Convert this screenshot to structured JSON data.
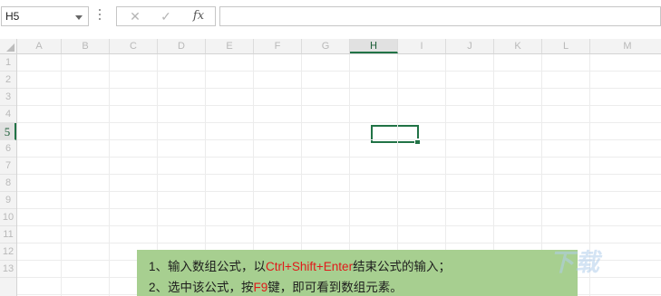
{
  "formula_bar": {
    "name_box": "H5",
    "cancel_glyph": "✕",
    "enter_glyph": "✓",
    "fx_label": "fx",
    "formula_value": ""
  },
  "columns": [
    "A",
    "B",
    "C",
    "D",
    "E",
    "F",
    "G",
    "H",
    "I",
    "J",
    "K",
    "L",
    "M"
  ],
  "active_column": "H",
  "rows": [
    "1",
    "2",
    "3",
    "4",
    "5",
    "6",
    "7",
    "8",
    "9",
    "10",
    "11",
    "12",
    "13"
  ],
  "active_row": "5",
  "selected_cell": "H5",
  "note": {
    "line1_prefix": "1、输入数组公式，以",
    "line1_highlight": "Ctrl+Shift+Enter",
    "line1_suffix": "结束公式的输入；",
    "line2_prefix": "2、选中该公式，按",
    "line2_highlight": "F9",
    "line2_suffix": "键，即可看到数组元素。"
  },
  "watermark": "下载",
  "colors": {
    "excel_green": "#217346",
    "note_background": "#a7cf90",
    "highlight_red": "#e01a1a"
  }
}
